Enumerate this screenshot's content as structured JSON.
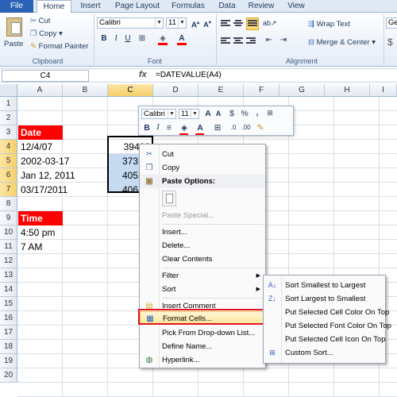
{
  "ribbon": {
    "tabs": [
      "File",
      "Home",
      "Insert",
      "Page Layout",
      "Formulas",
      "Data",
      "Review",
      "View"
    ],
    "clipboard": {
      "paste": "Paste",
      "cut": "Cut",
      "copy": "Copy ▾",
      "format_painter": "Format Painter",
      "label": "Clipboard"
    },
    "font": {
      "name": "Calibri",
      "size": "11",
      "label": "Font"
    },
    "alignment": {
      "wrap_text": "Wrap Text",
      "merge_center": "Merge & Center ▾",
      "label": "Alignment"
    },
    "number_format_partial": "Ge"
  },
  "formula_bar": {
    "name_box": "C4",
    "fx": "fx",
    "formula": "=DATEVALUE(A4)"
  },
  "grid": {
    "columns": [
      "A",
      "B",
      "C",
      "D",
      "E",
      "F",
      "G",
      "H",
      "I"
    ],
    "rows": [
      "1",
      "2",
      "3",
      "4",
      "5",
      "6",
      "7",
      "8",
      "9",
      "10",
      "11",
      "12",
      "13",
      "14",
      "15",
      "16",
      "17",
      "18",
      "19",
      "20"
    ],
    "cells": {
      "A3": "Date",
      "A4": "12/4/07",
      "A5": "2002-03-17",
      "A6": "Jan 12, 2011",
      "A7": "03/17/2011",
      "A9": "Time",
      "A10": "4:50 pm",
      "A11": "7 AM",
      "C4": "39420",
      "C5": "373",
      "C6": "405",
      "C7": "406"
    }
  },
  "mini_toolbar": {
    "font": "Calibri",
    "size": "11",
    "percent": "%",
    "comma": ","
  },
  "context_menu": {
    "items": [
      "Cut",
      "Copy",
      "Paste Options:",
      "Paste Special...",
      "Insert...",
      "Delete...",
      "Clear Contents",
      "Filter",
      "Sort",
      "Insert Comment",
      "Format Cells...",
      "Pick From Drop-down List...",
      "Define Name...",
      "Hyperlink..."
    ]
  },
  "sort_submenu": {
    "items": [
      "Sort Smallest to Largest",
      "Sort Largest to Smallest",
      "Put Selected Cell Color On Top",
      "Put Selected Font Color On Top",
      "Put Selected Cell Icon On Top",
      "Custom Sort..."
    ]
  },
  "colors": {
    "header_red": "#ff0000",
    "highlight_box": "#e4141c",
    "selection_fill": "#c6dbf1",
    "file_tab": "#2a62b8"
  }
}
